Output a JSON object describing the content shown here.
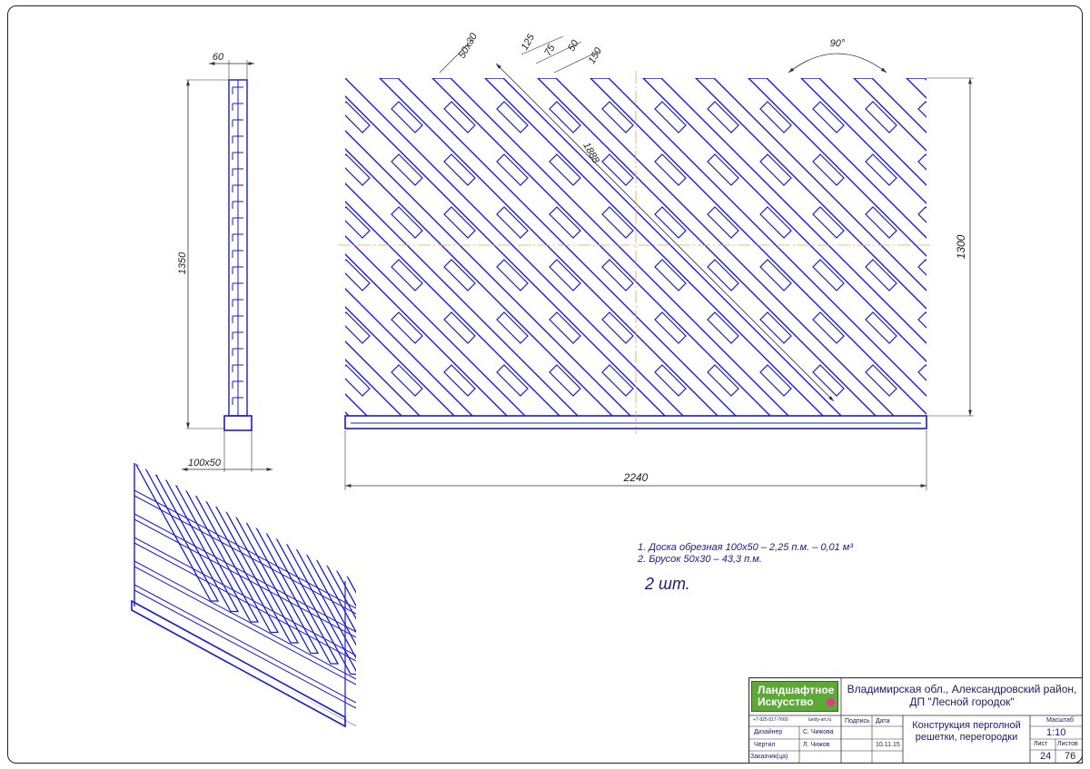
{
  "dimensions": {
    "side_height": "1350",
    "side_width_top": "60",
    "side_post": "100x50",
    "front_width": "2240",
    "front_height": "1300",
    "diagonal": "1888",
    "batten": "50x30",
    "spacing": [
      "125",
      "75",
      "50",
      "150"
    ],
    "angle": "90°"
  },
  "notes": {
    "item1": "1. Доска обрезная 100х50 – 2,25 п.м. – 0,01 м³",
    "item2": "2. Брусок 50х30 – 43,3 п.м.",
    "quantity": "2 шт."
  },
  "title_block": {
    "logo_line1": "Ландшафтное",
    "logo_line2": "Искусство",
    "phone": "+7-925-517-7660",
    "site": "landy-art.ru",
    "location": "Владимирская обл., Александровский район, ДП \"Лесной городок\"",
    "headers": {
      "signature": "Подпись",
      "date": "Дата",
      "scale": "Масштаб",
      "sheet": "Лист",
      "sheets": "Листов"
    },
    "roles": [
      {
        "role": "Дизайнер",
        "name": "С. Чижова"
      },
      {
        "role": "Чертил",
        "name": "Л. Чижов"
      },
      {
        "role": "Заказчик(ца)",
        "name": ""
      }
    ],
    "date": "10.11.15",
    "drawing_title": "Конструкция перголной решетки, перегородки",
    "scale_value": "1:10",
    "sheet_no": "24",
    "sheets_total": "76"
  },
  "colors": {
    "lines": "#1a1ad6",
    "axis": "#f0a050",
    "dim": "#333333",
    "logo_bg": "#5ea838",
    "logo_dot": "#e8338f"
  }
}
